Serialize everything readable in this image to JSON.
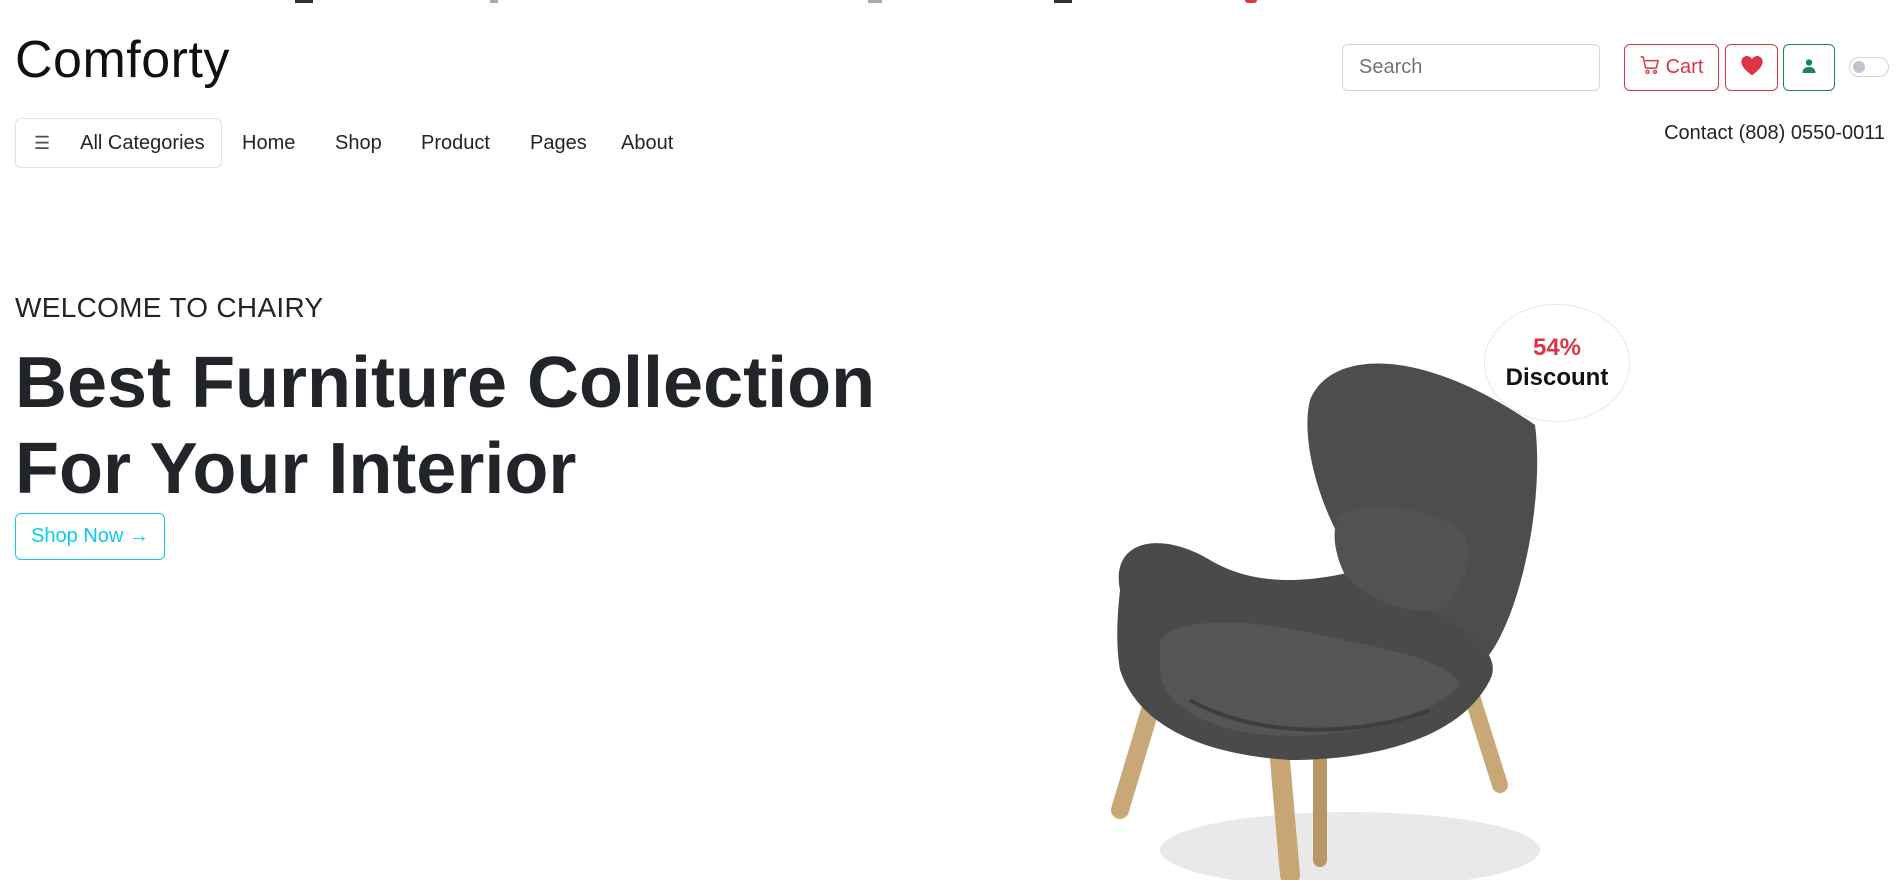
{
  "brand": {
    "name": "Comforty"
  },
  "header": {
    "search_placeholder": "Search",
    "cart_label": "Cart",
    "icons": {
      "cart": "cart-icon",
      "wishlist": "heart-icon",
      "account": "user-icon",
      "theme": "toggle-switch"
    }
  },
  "nav": {
    "categories_label": "All Categories",
    "items": [
      "Home",
      "Shop",
      "Product",
      "Pages",
      "About"
    ],
    "contact": "Contact (808) 0550-0011"
  },
  "hero": {
    "eyebrow": "WELCOME TO CHAIRY",
    "title_line1": "Best Furniture Collection",
    "title_line2": "For Your Interior",
    "cta_label": "Shop Now →",
    "discount_value": "54%",
    "discount_label": "Discount"
  },
  "colors": {
    "danger": "#dc3545",
    "success": "#198754",
    "info": "#0dcaf0",
    "text": "#212529",
    "chair_fabric": "#4a4a4a",
    "chair_wood": "#c9a877"
  }
}
